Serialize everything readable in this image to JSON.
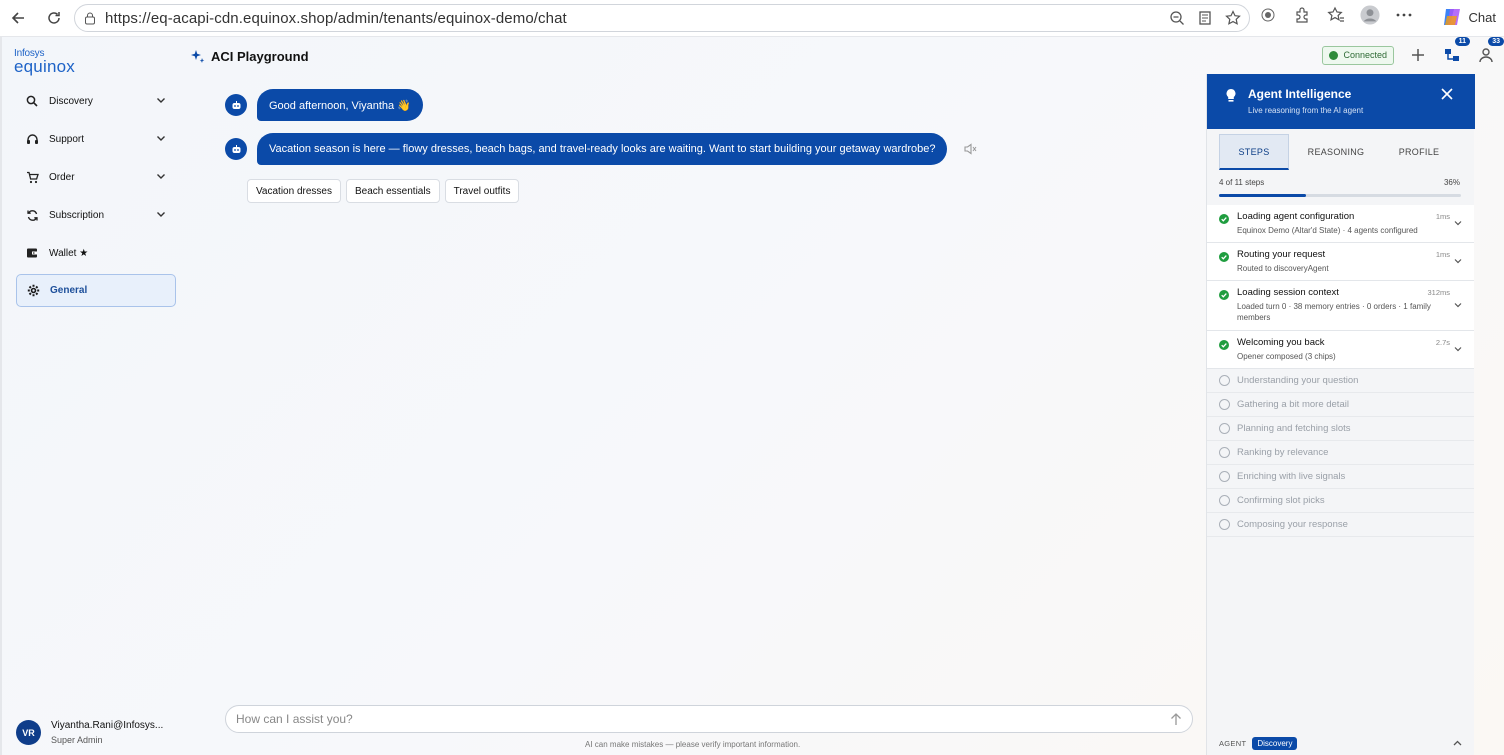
{
  "browser": {
    "url": "https://eq-acapi-cdn.equinox.shop/admin/tenants/equinox-demo/chat",
    "chat_label": "Chat"
  },
  "logo": {
    "small": "Infosys",
    "big": "equinox"
  },
  "sidebar": {
    "items": [
      {
        "label": "Discovery",
        "icon": "search-icon"
      },
      {
        "label": "Support",
        "icon": "headset-icon"
      },
      {
        "label": "Order",
        "icon": "cart-icon"
      },
      {
        "label": "Subscription",
        "icon": "refresh-icon"
      },
      {
        "label": "Wallet ★",
        "icon": "wallet-icon"
      },
      {
        "label": "General",
        "icon": "gear-icon"
      }
    ],
    "user": {
      "initials": "VR",
      "email": "Viyantha.Rani@Infosys...",
      "role": "Super Admin"
    }
  },
  "header": {
    "title": "ACI Playground",
    "status": "Connected",
    "badge_tree": "11",
    "badge_user": "33"
  },
  "chat": {
    "messages": [
      "Good afternoon, Viyantha 👋",
      "Vacation season is here — flowy dresses, beach bags, and travel-ready looks are waiting. Want to start building your getaway wardrobe?"
    ],
    "chips": [
      "Vacation dresses",
      "Beach essentials",
      "Travel outfits"
    ],
    "input_placeholder": "How can I assist you?",
    "disclaimer": "AI can make mistakes — please verify important information."
  },
  "panel": {
    "title": "Agent Intelligence",
    "subtitle": "Live reasoning from the AI agent",
    "tabs": [
      "STEPS",
      "REASONING",
      "PROFILE"
    ],
    "progress_label": "4 of 11 steps",
    "progress_pct": "36%",
    "progress_value": 0.36,
    "done_steps": [
      {
        "title": "Loading agent configuration",
        "sub": "Equinox Demo (Altar'd State) · 4 agents configured",
        "time": "1ms"
      },
      {
        "title": "Routing your request",
        "sub": "Routed to discoveryAgent",
        "time": "1ms"
      },
      {
        "title": "Loading session context",
        "sub": "Loaded turn 0 · 38 memory entries · 0 orders · 1 family members",
        "time": "312ms"
      },
      {
        "title": "Welcoming you back",
        "sub": "Opener composed (3 chips)",
        "time": "2.7s"
      }
    ],
    "todo_steps": [
      "Understanding your question",
      "Gathering a bit more detail",
      "Planning and fetching slots",
      "Ranking by relevance",
      "Enriching with live signals",
      "Confirming slot picks",
      "Composing your response"
    ],
    "footer_label": "AGENT",
    "footer_agent": "Discovery"
  }
}
